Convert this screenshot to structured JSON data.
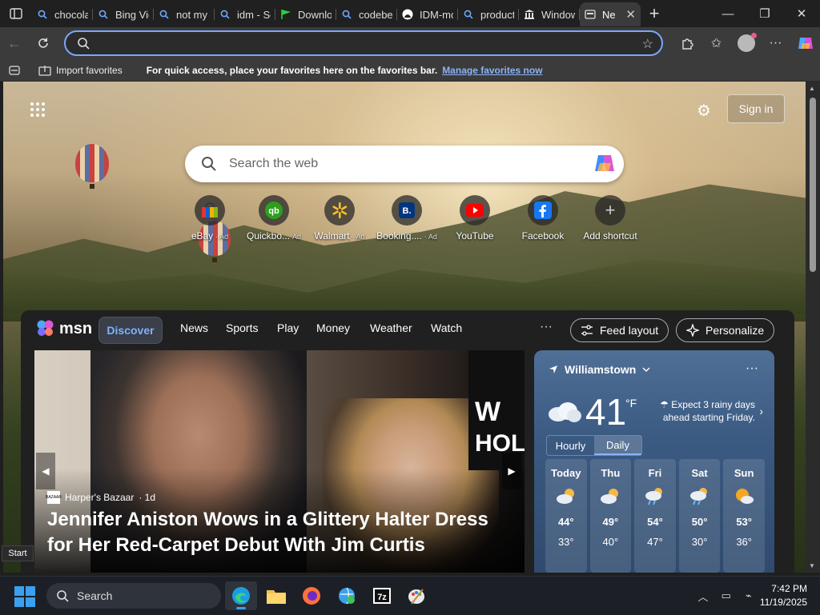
{
  "browser": {
    "tabs": [
      {
        "title": "chocolat",
        "icon": "search-icon"
      },
      {
        "title": "Bing Vid",
        "icon": "search-icon"
      },
      {
        "title": "not my t",
        "icon": "search-icon"
      },
      {
        "title": "idm - Se",
        "icon": "search-icon"
      },
      {
        "title": "Downlo",
        "icon": "flag-icon"
      },
      {
        "title": "codebe",
        "icon": "search-icon"
      },
      {
        "title": "IDM-mo",
        "icon": "github-icon"
      },
      {
        "title": "product",
        "icon": "search-icon"
      },
      {
        "title": "Window",
        "icon": "bank-icon"
      },
      {
        "title": "Ne",
        "icon": "newtab-icon",
        "active": true
      }
    ],
    "address_value": "",
    "favorites_bar": {
      "import_label": "Import favorites",
      "message": "For quick access, place your favorites here on the favorites bar.",
      "manage_link": "Manage favorites now"
    }
  },
  "newtab": {
    "sign_in": "Sign in",
    "search_placeholder": "Search the web",
    "shortcuts": [
      {
        "label": "eBay",
        "ad": "· Ad"
      },
      {
        "label": "Quickbo...",
        "ad": "Ad"
      },
      {
        "label": "Walmart",
        "ad": "· Ad"
      },
      {
        "label": "Booking....",
        "ad": "· Ad"
      },
      {
        "label": "YouTube",
        "ad": ""
      },
      {
        "label": "Facebook",
        "ad": ""
      },
      {
        "label": "Add shortcut",
        "ad": ""
      }
    ]
  },
  "feed": {
    "logo_text": "msn",
    "nav": [
      "Discover",
      "News",
      "Sports",
      "Play",
      "Money",
      "Weather",
      "Watch"
    ],
    "more": "···",
    "feed_layout": "Feed layout",
    "personalize": "Personalize",
    "hero": {
      "source": "Harper's Bazaar",
      "age": "· 1d",
      "source_logo_text": "BAZAAR",
      "headline": "Jennifer Aniston Wows in a Glittery Halter Dress for Her Red-Carpet Debut With Jim Curtis",
      "wall_text_1": "W",
      "wall_text_2": "HOL"
    }
  },
  "weather": {
    "location": "Williamstown",
    "temperature": "41",
    "unit": "°F",
    "note": "Expect 3 rainy days ahead starting Friday.",
    "modes": [
      "Hourly",
      "Daily"
    ],
    "days": [
      {
        "name": "Today",
        "hi": "44°",
        "lo": "33°",
        "icon": "partly-cloudy-icon"
      },
      {
        "name": "Thu",
        "hi": "49°",
        "lo": "40°",
        "icon": "partly-cloudy-icon"
      },
      {
        "name": "Fri",
        "hi": "54°",
        "lo": "47°",
        "icon": "rain-icon"
      },
      {
        "name": "Sat",
        "hi": "50°",
        "lo": "30°",
        "icon": "rain-icon"
      },
      {
        "name": "Sun",
        "hi": "53°",
        "lo": "36°",
        "icon": "sun-cloud-icon"
      }
    ]
  },
  "taskbar": {
    "search_label": "Search",
    "start_tooltip": "Start",
    "time": "7:42 PM",
    "date": "11/19/2025"
  }
}
